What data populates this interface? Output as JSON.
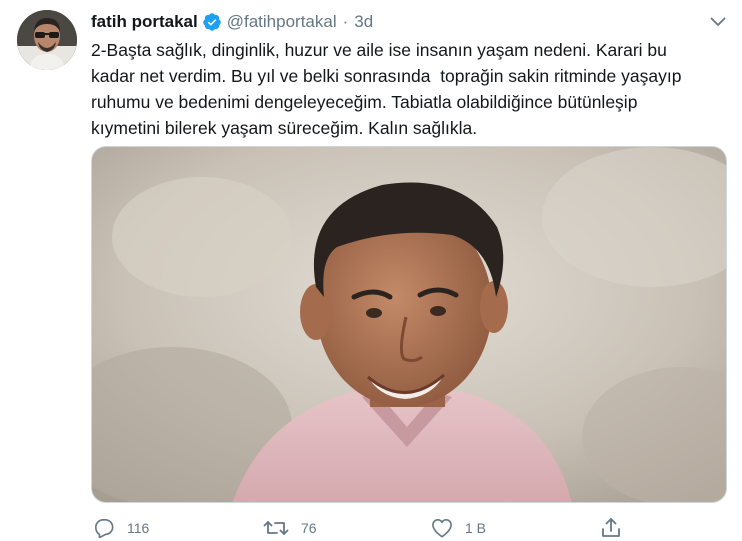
{
  "tweet": {
    "display_name": "fatih portakal",
    "handle": "@fatihportakal",
    "separator": "·",
    "time": "3d",
    "verified": true,
    "text": "2-Başta sağlık, dinginlik, huzur ve aile ise insanın yaşam nedeni. Karari bu\nkadar net verdim. Bu yıl ve belki sonrasında  toprağin sakin ritminde yaşayıp\nruhumu ve bedenimi dengeleyeceğim. Tabiatla olabildiğince bütünleşip\nkıymetini bilerek yaşam süreceğim. Kalın sağlıkla."
  },
  "actions": {
    "reply_count": "116",
    "retweet_count": "76",
    "like_count": "1 B"
  },
  "colors": {
    "verified_blue": "#1da1f2",
    "muted_gray": "#657786",
    "text": "#14171a",
    "border": "#ccd6dd"
  },
  "icons": [
    "avatar",
    "verified-badge-icon",
    "chevron-down-icon",
    "reply-icon",
    "retweet-icon",
    "like-icon",
    "share-icon"
  ]
}
